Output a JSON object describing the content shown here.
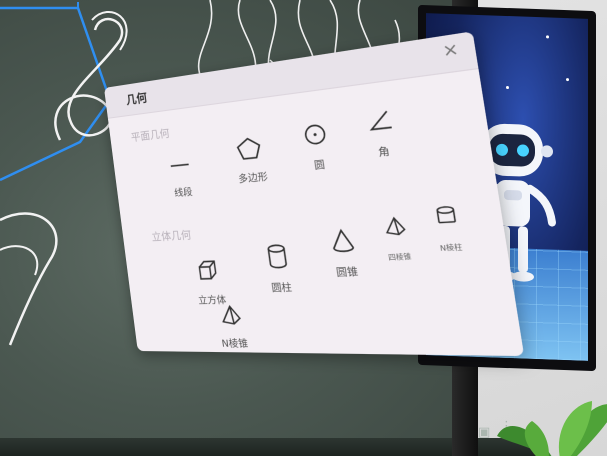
{
  "panel": {
    "title": "几何",
    "close_glyph": "×",
    "sections": [
      {
        "label": "平面几何",
        "tools": [
          {
            "label": "线段",
            "icon": "line-segment-icon"
          },
          {
            "label": "多边形",
            "icon": "polygon-icon"
          },
          {
            "label": "圆",
            "icon": "circle-icon"
          },
          {
            "label": "角",
            "icon": "angle-icon"
          }
        ]
      },
      {
        "label": "立体几何",
        "tools": [
          {
            "label": "立方体",
            "icon": "cube-icon"
          },
          {
            "label": "圆柱",
            "icon": "cylinder-icon"
          },
          {
            "label": "圆锥",
            "icon": "cone-icon"
          },
          {
            "label": "四棱锥",
            "icon": "square-pyramid-icon"
          },
          {
            "label": "N棱柱",
            "icon": "n-prism-icon"
          },
          {
            "label": "N棱锥",
            "icon": "n-pyramid-icon"
          }
        ]
      }
    ]
  },
  "colors": {
    "board": "#4b5851",
    "panel": "#f3eef3",
    "panel_header": "#e8e3ea",
    "ink_white": "#f2f2f2",
    "ink_blue": "#2f8ef0",
    "display_bg": "#14245e"
  }
}
